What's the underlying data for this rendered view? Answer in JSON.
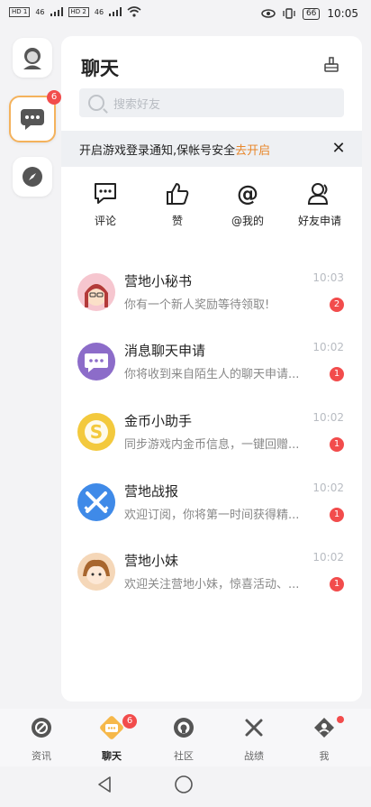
{
  "status_bar": {
    "time": "10:05",
    "battery": "66",
    "sim1_tag": "HD 1",
    "sim2_tag": "HD 2",
    "sim1_signal": "46",
    "sim2_signal": "46",
    "icons": [
      "eye-icon",
      "vibrate-icon",
      "wifi-icon",
      "signal-icon"
    ]
  },
  "rail": {
    "chat_badge": "6"
  },
  "panel": {
    "title": "聊天",
    "search_placeholder": "搜索好友",
    "notice_text": "开启游戏登录通知,保帐号安全",
    "notice_link": "去开启",
    "notice_close": "✕",
    "quick_actions": [
      {
        "label": "评论",
        "icon": "comment-icon"
      },
      {
        "label": "赞",
        "icon": "thumbs-up-icon"
      },
      {
        "label": "@我的",
        "icon": "at-icon"
      },
      {
        "label": "好友申请",
        "icon": "friend-request-icon"
      }
    ],
    "messages": [
      {
        "title": "营地小秘书",
        "preview": "你有一个新人奖励等待领取!",
        "time": "10:03",
        "badge": "2",
        "avatar_color": "#f6c6cf"
      },
      {
        "title": "消息聊天申请",
        "preview": "你将收到来自陌生人的聊天申请...",
        "time": "10:02",
        "badge": "1",
        "avatar_color": "#8c6cc9"
      },
      {
        "title": "金币小助手",
        "preview": "同步游戏内金币信息，一键回赠...",
        "time": "10:02",
        "badge": "1",
        "avatar_color": "#f3c93d"
      },
      {
        "title": "营地战报",
        "preview": "欢迎订阅，你将第一时间获得精...",
        "time": "10:02",
        "badge": "1",
        "avatar_color": "#3f8ae8"
      },
      {
        "title": "营地小妹",
        "preview": "欢迎关注营地小妹，惊喜活动、...",
        "time": "10:02",
        "badge": "1",
        "avatar_color": "#f5d7b8"
      }
    ]
  },
  "bottom_nav": {
    "items": [
      {
        "label": "资讯",
        "icon": "news-icon"
      },
      {
        "label": "聊天",
        "icon": "chat-icon",
        "badge": "6"
      },
      {
        "label": "社区",
        "icon": "community-icon"
      },
      {
        "label": "战绩",
        "icon": "battle-record-icon"
      },
      {
        "label": "我",
        "icon": "me-icon"
      }
    ]
  },
  "colors": {
    "accent_orange": "#e8862a",
    "badge_red": "#f24c4c",
    "active_border": "#f4b25c",
    "active_nav": "#f6b84a"
  }
}
